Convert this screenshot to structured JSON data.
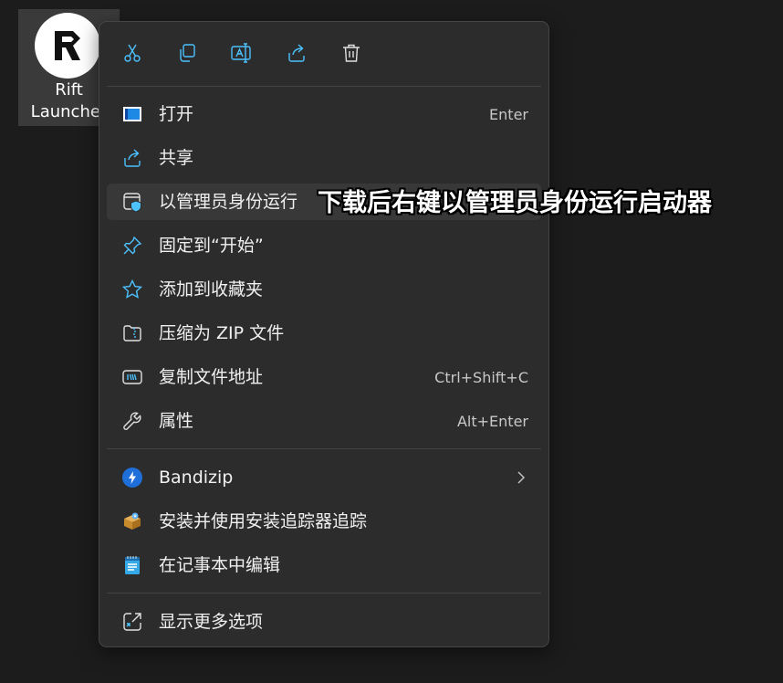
{
  "desktop_icon": {
    "label": "Rift\nLauncher",
    "icon": "rift-launcher-logo-icon"
  },
  "menu": {
    "toolbar": [
      {
        "name": "cut",
        "icon": "scissors-icon"
      },
      {
        "name": "copy",
        "icon": "copy-icon"
      },
      {
        "name": "rename",
        "icon": "rename-icon"
      },
      {
        "name": "share",
        "icon": "share-icon"
      },
      {
        "name": "delete",
        "icon": "trash-icon"
      }
    ],
    "items": [
      {
        "label": "打开",
        "shortcut": "Enter",
        "icon": "open-window-icon"
      },
      {
        "label": "共享",
        "shortcut": "",
        "icon": "share-icon"
      },
      {
        "label": "以管理员身份运行",
        "shortcut": "",
        "icon": "admin-shield-icon"
      },
      {
        "label": "固定到“开始”",
        "shortcut": "",
        "icon": "pin-icon"
      },
      {
        "label": "添加到收藏夹",
        "shortcut": "",
        "icon": "star-icon"
      },
      {
        "label": "压缩为 ZIP 文件",
        "shortcut": "",
        "icon": "zip-icon"
      },
      {
        "label": "复制文件地址",
        "shortcut": "Ctrl+Shift+C",
        "icon": "copy-path-icon"
      },
      {
        "label": "属性",
        "shortcut": "Alt+Enter",
        "icon": "wrench-icon"
      },
      {
        "label": "Bandizip",
        "shortcut": "",
        "icon": "bandizip-icon"
      },
      {
        "label": "安装并使用安装追踪器追踪",
        "shortcut": "",
        "icon": "installer-box-icon"
      },
      {
        "label": "在记事本中编辑",
        "shortcut": "",
        "icon": "notepad-icon"
      },
      {
        "label": "显示更多选项",
        "shortcut": "",
        "icon": "more-options-icon"
      }
    ]
  },
  "annotation": "下载后右键以管理员身份运行启动器",
  "colors": {
    "accent": "#4cc2ff",
    "menu_bg": "#2c2c2c",
    "hover_bg": "#383838",
    "desktop_bg": "#1c1c1c"
  }
}
